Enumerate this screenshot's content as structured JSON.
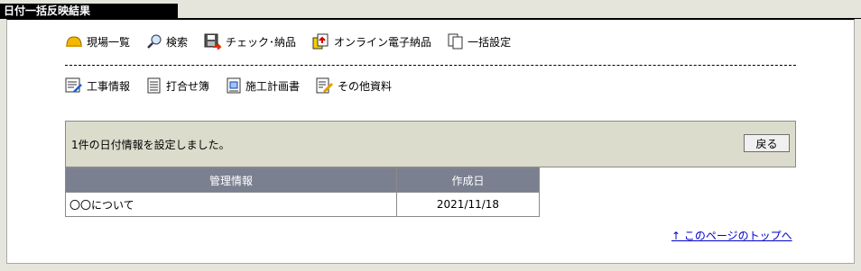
{
  "page": {
    "title": "日付一括反映結果"
  },
  "nav_top": [
    {
      "label": "現場一覧",
      "icon": "helmet-icon"
    },
    {
      "label": "検索",
      "icon": "magnifier-icon"
    },
    {
      "label": "チェック･納品",
      "icon": "floppy-check-icon"
    },
    {
      "label": "オンライン電子納品",
      "icon": "online-delivery-icon"
    },
    {
      "label": "一括設定",
      "icon": "document-copy-icon"
    }
  ],
  "nav_bottom": [
    {
      "label": "工事情報",
      "icon": "construction-info-icon"
    },
    {
      "label": "打合せ簿",
      "icon": "meeting-record-icon"
    },
    {
      "label": "施工計画書",
      "icon": "plan-book-icon"
    },
    {
      "label": "その他資料",
      "icon": "other-docs-icon"
    }
  ],
  "message": {
    "text": "1件の日付情報を設定しました。",
    "back_label": "戻る"
  },
  "table": {
    "headers": [
      "管理情報",
      "作成日"
    ],
    "rows": [
      [
        "〇〇について",
        "2021/11/18"
      ]
    ]
  },
  "footer": {
    "top_link": "↑ このページのトップへ"
  }
}
